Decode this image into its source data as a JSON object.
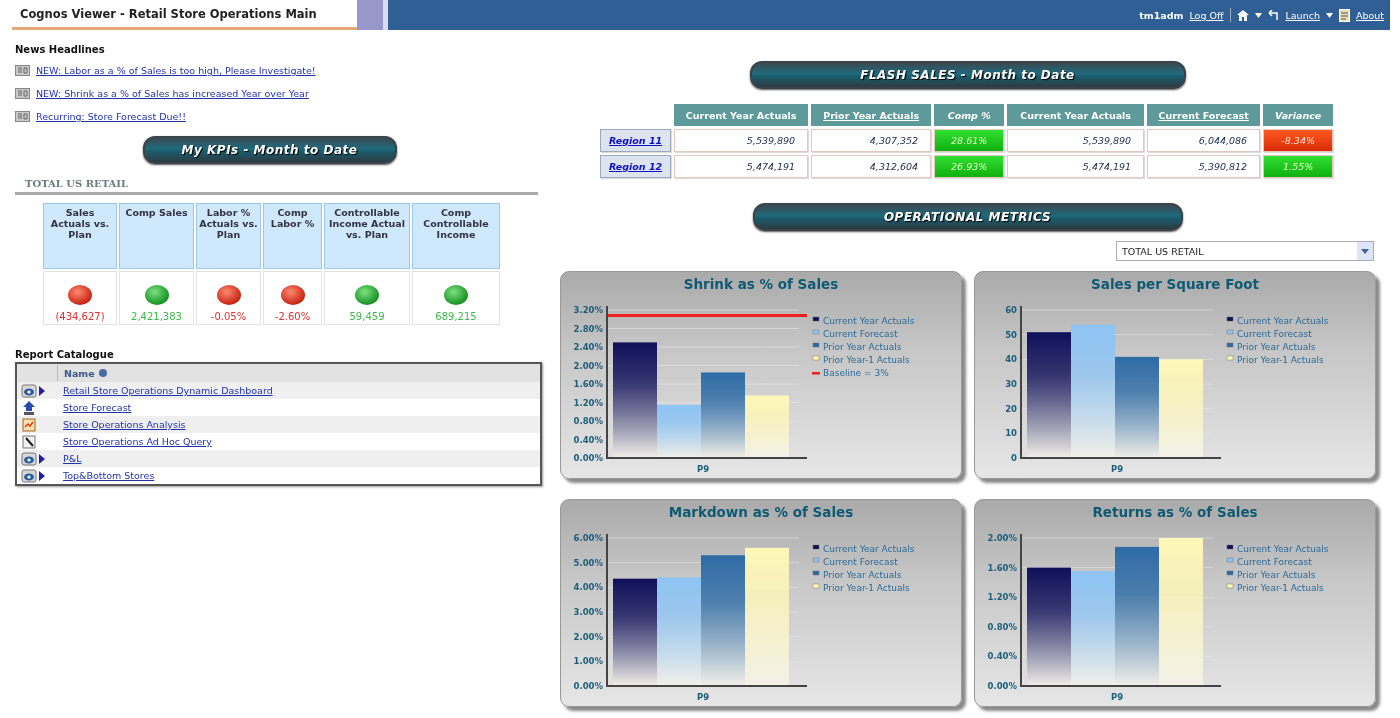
{
  "header": {
    "title": "Cognos Viewer - Retail Store Operations Main",
    "user": "tm1adm",
    "logoff": "Log Off",
    "launch": "Launch",
    "about": "About"
  },
  "news": {
    "title": "News Headlines",
    "items": [
      "NEW: Labor as a % of Sales is too high, Please Investigate!",
      "NEW: Shrink as a % of Sales has increased Year over Year",
      "Recurring: Store Forecast Due!!"
    ]
  },
  "kpi": {
    "banner": "My KPIs - Month to Date",
    "section": "TOTAL US RETAIL",
    "columns": [
      "Sales Actuals vs. Plan",
      "Comp Sales",
      "Labor % Actuals vs. Plan",
      "Comp Labor %",
      "Controllable Income Actual vs. Plan",
      "Comp Controllable Income"
    ],
    "values": [
      {
        "text": "(434,627)",
        "kind": "bad"
      },
      {
        "text": "2,421,383",
        "kind": "good"
      },
      {
        "text": "-0.05%",
        "kind": "bad"
      },
      {
        "text": "-2.60%",
        "kind": "bad"
      },
      {
        "text": "59,459",
        "kind": "good"
      },
      {
        "text": "689,215",
        "kind": "good"
      }
    ]
  },
  "catalogue": {
    "title": "Report Catalogue",
    "column": "Name",
    "rows": [
      {
        "kind": "report",
        "name": "Retail Store Operations Dynamic Dashboard"
      },
      {
        "kind": "forecast",
        "name": "Store Forecast"
      },
      {
        "kind": "analysis",
        "name": "Store Operations Analysis"
      },
      {
        "kind": "query",
        "name": "Store Operations Ad Hoc Query"
      },
      {
        "kind": "report",
        "name": "P&L"
      },
      {
        "kind": "report",
        "name": "Top&Bottom Stores"
      }
    ]
  },
  "flash": {
    "banner": "FLASH SALES - Month to Date",
    "columns": [
      {
        "label": "Current Year Actuals",
        "kind": "plain"
      },
      {
        "label": "Prior Year Actuals",
        "kind": "link"
      },
      {
        "label": "Comp %",
        "kind": "italic"
      },
      {
        "label": "Current Year Actuals",
        "kind": "plain"
      },
      {
        "label": "Current Forecast",
        "kind": "link"
      },
      {
        "label": "Variance",
        "kind": "italic"
      }
    ],
    "rows": [
      {
        "label": "Region 11",
        "cells": [
          {
            "text": "5,539,890"
          },
          {
            "text": "4,307,352"
          },
          {
            "text": "28.61%",
            "kind": "good"
          },
          {
            "text": "5,539,890"
          },
          {
            "text": "6,044,086"
          },
          {
            "text": "-8.34%",
            "kind": "bad"
          }
        ]
      },
      {
        "label": "Region 12",
        "cells": [
          {
            "text": "5,474,191"
          },
          {
            "text": "4,312,604"
          },
          {
            "text": "26.93%",
            "kind": "good"
          },
          {
            "text": "5,474,191"
          },
          {
            "text": "5,390,812"
          },
          {
            "text": "1.55%",
            "kind": "good"
          }
        ]
      }
    ]
  },
  "metrics": {
    "banner": "OPERATIONAL METRICS",
    "filter": "TOTAL US RETAIL",
    "charts": [
      {
        "chart_data": {
          "type": "bar",
          "title": "Shrink as % of Sales",
          "categories": [
            "P9"
          ],
          "ylim": [
            0,
            3.2
          ],
          "yticks": [
            {
              "value": 0,
              "label": "0.00%"
            },
            {
              "value": 0.4,
              "label": "0.40%"
            },
            {
              "value": 0.8,
              "label": "0.80%"
            },
            {
              "value": 1.2,
              "label": "1.20%"
            },
            {
              "value": 1.6,
              "label": "1.60%"
            },
            {
              "value": 2.0,
              "label": "2.00%"
            },
            {
              "value": 2.4,
              "label": "2.40%"
            },
            {
              "value": 2.8,
              "label": "2.80%"
            },
            {
              "value": 3.2,
              "label": "3.20%"
            }
          ],
          "series": [
            {
              "name": "Current Year Actuals",
              "color": "#10105a",
              "values": [
                2.5
              ]
            },
            {
              "name": "Current Forecast",
              "color": "#8ec4f4",
              "values": [
                1.15
              ]
            },
            {
              "name": "Prior Year Actuals",
              "color": "#2e6ca6",
              "values": [
                1.85
              ]
            },
            {
              "name": "Prior Year-1 Actuals",
              "color": "#fff8b8",
              "values": [
                1.35
              ]
            }
          ],
          "ref_lines": [
            {
              "axis": "y",
              "value": 3.08,
              "label": "Baseline = 3%",
              "color": "#ee2020"
            }
          ],
          "grid": true,
          "legend": "right"
        }
      },
      {
        "chart_data": {
          "type": "bar",
          "title": "Sales per Square Foot",
          "categories": [
            "P9"
          ],
          "ylim": [
            0,
            60
          ],
          "yticks": [
            0,
            10,
            20,
            30,
            40,
            50,
            60
          ],
          "series": [
            {
              "name": "Current Year Actuals",
              "color": "#10105a",
              "values": [
                51
              ]
            },
            {
              "name": "Current Forecast",
              "color": "#8ec4f4",
              "values": [
                54
              ]
            },
            {
              "name": "Prior Year Actuals",
              "color": "#2e6ca6",
              "values": [
                41
              ]
            },
            {
              "name": "Prior Year-1 Actuals",
              "color": "#fff8b8",
              "values": [
                40
              ]
            }
          ],
          "grid": true,
          "legend": "right"
        }
      },
      {
        "chart_data": {
          "type": "bar",
          "title": "Markdown as % of Sales",
          "categories": [
            "P9"
          ],
          "ylim": [
            0,
            6
          ],
          "yticks": [
            {
              "value": 0,
              "label": "0.00%"
            },
            {
              "value": 1,
              "label": "1.00%"
            },
            {
              "value": 2,
              "label": "2.00%"
            },
            {
              "value": 3,
              "label": "3.00%"
            },
            {
              "value": 4,
              "label": "4.00%"
            },
            {
              "value": 5,
              "label": "5.00%"
            },
            {
              "value": 6,
              "label": "6.00%"
            }
          ],
          "series": [
            {
              "name": "Current Year Actuals",
              "color": "#10105a",
              "values": [
                4.35
              ]
            },
            {
              "name": "Current Forecast",
              "color": "#8ec4f4",
              "values": [
                4.4
              ]
            },
            {
              "name": "Prior Year Actuals",
              "color": "#2e6ca6",
              "values": [
                5.3
              ]
            },
            {
              "name": "Prior Year-1 Actuals",
              "color": "#fff8b8",
              "values": [
                5.6
              ]
            }
          ],
          "grid": true,
          "legend": "right"
        }
      },
      {
        "chart_data": {
          "type": "bar",
          "title": "Returns as % of Sales",
          "categories": [
            "P9"
          ],
          "ylim": [
            0,
            2.0
          ],
          "yticks": [
            {
              "value": 0,
              "label": "0.00%"
            },
            {
              "value": 0.4,
              "label": "0.40%"
            },
            {
              "value": 0.8,
              "label": "0.80%"
            },
            {
              "value": 1.2,
              "label": "1.20%"
            },
            {
              "value": 1.6,
              "label": "1.60%"
            },
            {
              "value": 2.0,
              "label": "2.00%"
            }
          ],
          "series": [
            {
              "name": "Current Year Actuals",
              "color": "#10105a",
              "values": [
                1.6
              ]
            },
            {
              "name": "Current Forecast",
              "color": "#8ec4f4",
              "values": [
                1.55
              ]
            },
            {
              "name": "Prior Year Actuals",
              "color": "#2e6ca6",
              "values": [
                1.88
              ]
            },
            {
              "name": "Prior Year-1 Actuals",
              "color": "#fff8b8",
              "values": [
                2.0
              ]
            }
          ],
          "grid": true,
          "legend": "right"
        }
      }
    ]
  }
}
